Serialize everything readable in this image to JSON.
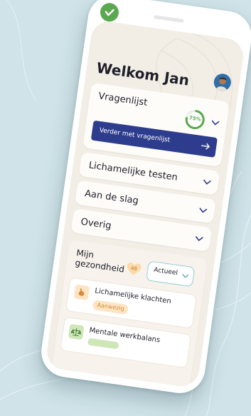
{
  "app": {
    "welcome_title": "Welkom Jan"
  },
  "sections": [
    {
      "label": "Vragenlijst",
      "progress_percent": 75,
      "progress_text": "75%",
      "cta_label": "Verder met vragenlijst"
    },
    {
      "label": "Lichamelijke testen"
    },
    {
      "label": "Aan de slag"
    },
    {
      "label": "Overig"
    }
  ],
  "health": {
    "title": "Mijn gezondheid",
    "score": "48",
    "filter_selected": "Actueel",
    "items": [
      {
        "label": "Lichamelijke klachten",
        "badge": "Aanwezig",
        "icon": "stomach-icon"
      },
      {
        "label": "Mentale werkbalans",
        "icon": "balance-icon"
      }
    ]
  },
  "colors": {
    "accent_blue": "#2d3c8c",
    "success_green": "#5aa84f",
    "badge_orange": "#d08a3b",
    "screen_bg": "#f2eee6"
  }
}
